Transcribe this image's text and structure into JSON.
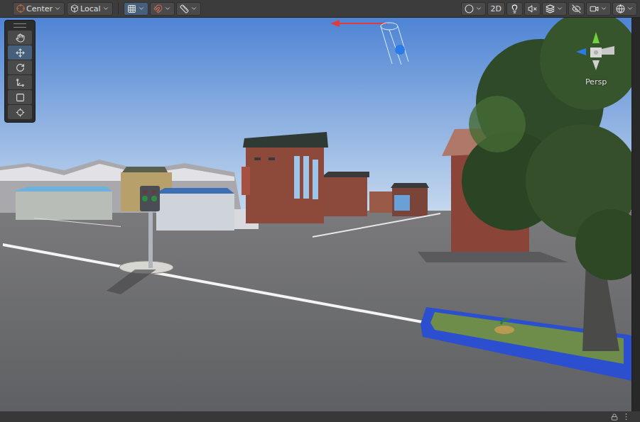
{
  "toolbar": {
    "pivot_mode": "Center",
    "pivot_rotation": "Local",
    "grid_visible": true,
    "grid_snap": false,
    "view_2d": {
      "label": "2D",
      "selected": false
    },
    "lighting": true,
    "audio_muted": true,
    "effects": true,
    "hidden_objects": false
  },
  "tools": [
    {
      "kind": "hand",
      "selected": false
    },
    {
      "kind": "move",
      "selected": true
    },
    {
      "kind": "rotate",
      "selected": false
    },
    {
      "kind": "scale",
      "selected": false
    },
    {
      "kind": "rect",
      "selected": false
    },
    {
      "kind": "transform",
      "selected": false
    }
  ],
  "scene_gizmo": {
    "projection": "Persp"
  },
  "footer": {
    "locked": true,
    "menu": "⋮"
  }
}
